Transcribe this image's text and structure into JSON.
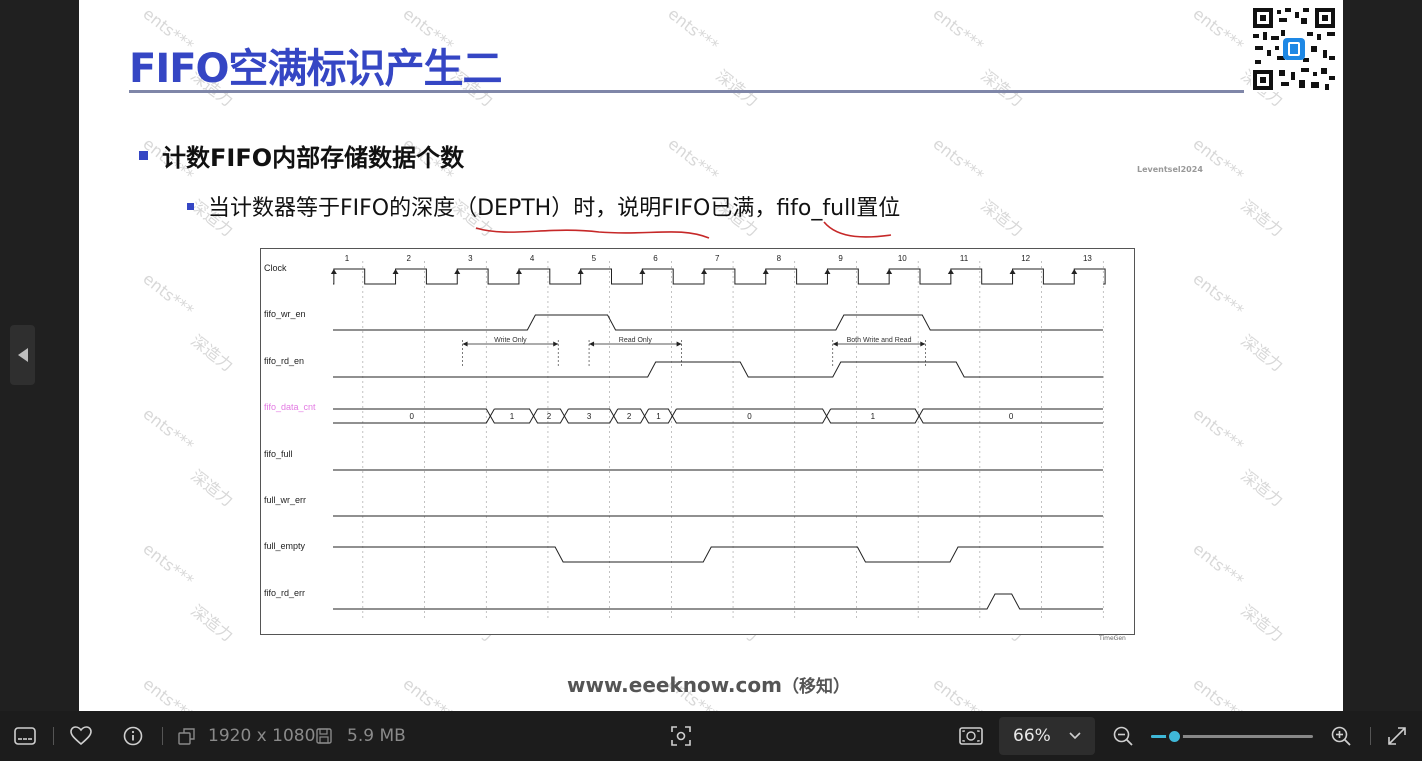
{
  "slide": {
    "title": "FIFO空满标识产生二",
    "bullet1": "计数FIFO内部存储数据个数",
    "bullet2": "当计数器等于FIFO的深度（DEPTH）时，说明FIFO已满，fifo_full置位",
    "author": "Leventsel2024",
    "website": "www.eeeknow.com",
    "website_cn": "（移知）",
    "timegen": "TimeGen",
    "watermark_a": "ents***",
    "watermark_b": "深造力"
  },
  "chart_data": {
    "type": "timing-diagram",
    "clock_cycles": [
      "1",
      "2",
      "3",
      "4",
      "5",
      "6",
      "7",
      "8",
      "9",
      "10",
      "11",
      "12",
      "13"
    ],
    "signals": [
      {
        "name": "Clock"
      },
      {
        "name": "fifo_wr_en",
        "high": [
          [
            3.15,
            4.45
          ],
          [
            8.15,
            9.55
          ]
        ]
      },
      {
        "name": "fifo_rd_en",
        "high": [
          [
            5.1,
            6.6
          ],
          [
            8.1,
            10.1
          ]
        ]
      },
      {
        "name": "fifo_data_cnt",
        "values": [
          "0",
          "1",
          "2",
          "3",
          "2",
          "1",
          "0",
          "1",
          "0"
        ]
      },
      {
        "name": "fifo_full",
        "high": []
      },
      {
        "name": "full_wr_err",
        "high": []
      },
      {
        "name": "full_empty",
        "high": [
          [
            0,
            3.6
          ],
          [
            6.0,
            8.5
          ],
          [
            10.0,
            13.5
          ]
        ]
      },
      {
        "name": "fifo_rd_err",
        "high": [
          [
            10.6,
            11.0
          ]
        ]
      }
    ],
    "annotations": [
      "Write Only",
      "Read Only",
      "Both Write and Read"
    ]
  },
  "toolbar": {
    "dimensions": "1920 x 1080",
    "filesize": "5.9 MB",
    "zoom": "66%",
    "zoom_fraction": 0.14
  },
  "colors": {
    "title": "#3546c4",
    "accent": "#3fb8d8",
    "cnt_label": "#e37ae3",
    "annotation": "#c62828"
  }
}
